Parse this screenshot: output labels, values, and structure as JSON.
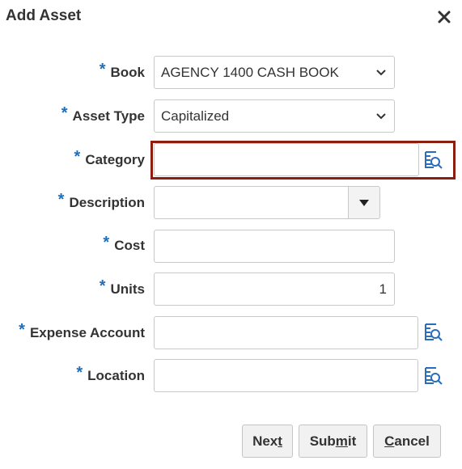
{
  "dialog": {
    "title": "Add Asset"
  },
  "required_marker": "*",
  "fields": {
    "book": {
      "label": "Book",
      "value": "AGENCY 1400 CASH BOOK"
    },
    "asset_type": {
      "label": "Asset Type",
      "value": "Capitalized"
    },
    "category": {
      "label": "Category",
      "value": ""
    },
    "description": {
      "label": "Description",
      "value": ""
    },
    "cost": {
      "label": "Cost",
      "value": ""
    },
    "units": {
      "label": "Units",
      "value": "1"
    },
    "expense_account": {
      "label": "Expense Account",
      "value": ""
    },
    "location": {
      "label": "Location",
      "value": ""
    }
  },
  "buttons": {
    "next": {
      "pre": "Nex",
      "mnemonic": "t",
      "post": ""
    },
    "submit": {
      "pre": "Sub",
      "mnemonic": "m",
      "post": "it"
    },
    "cancel": {
      "pre": "",
      "mnemonic": "C",
      "post": "ancel"
    }
  },
  "icons": {
    "close": "close-icon",
    "chevron": "chevron-down-icon",
    "search": "search-list-icon",
    "combo": "triangle-down-icon"
  },
  "colors": {
    "required": "#1f6fba",
    "highlight": "#8b1e0e",
    "search_icon": "#2a6ebb"
  }
}
